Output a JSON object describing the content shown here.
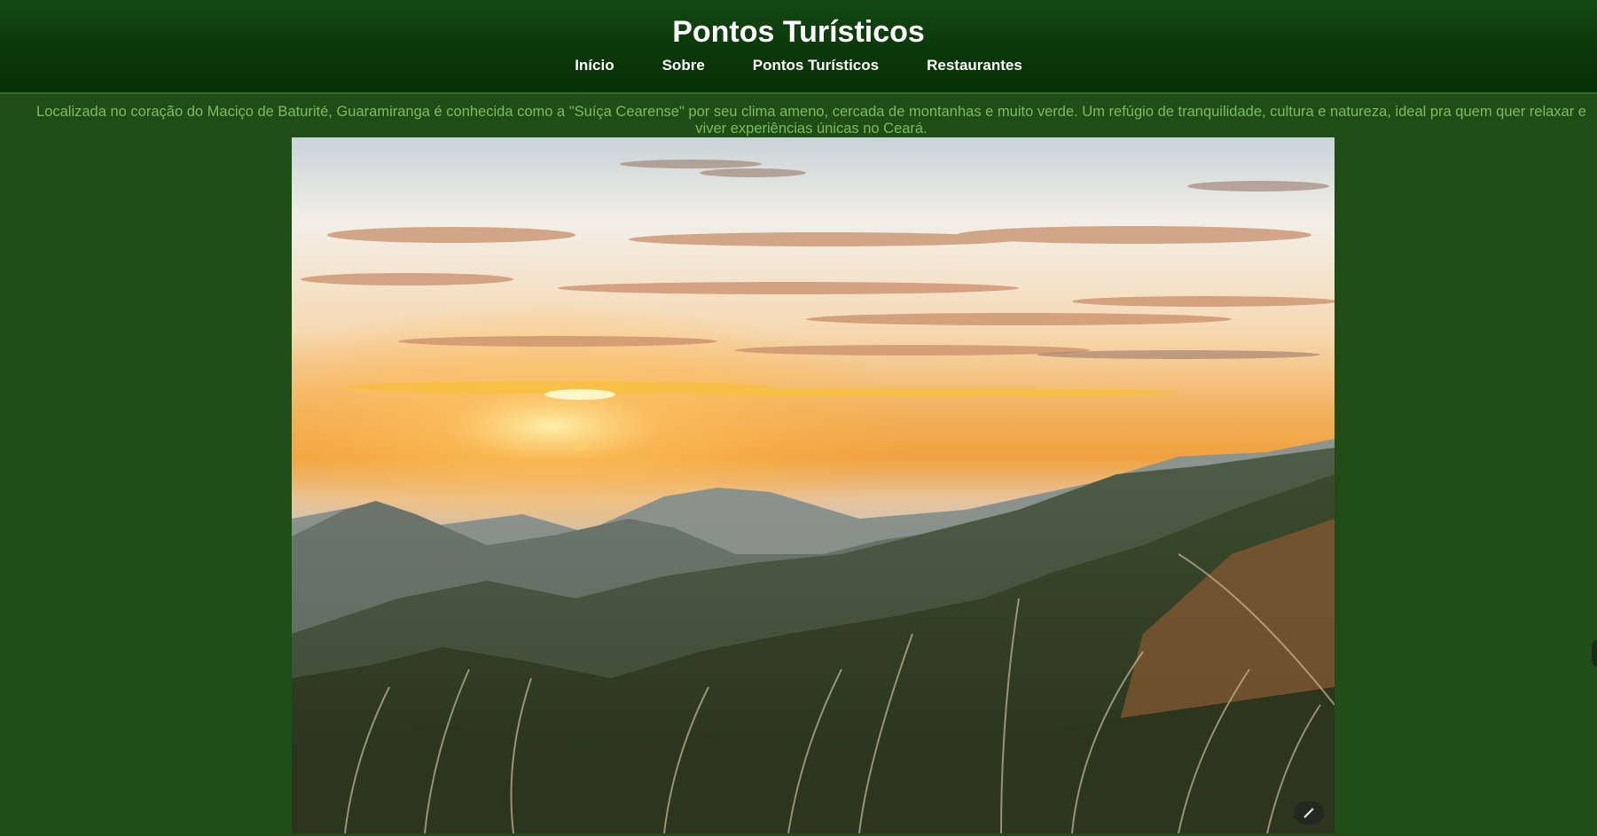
{
  "header": {
    "title": "Pontos Turísticos",
    "nav": [
      {
        "label": "Início"
      },
      {
        "label": "Sobre"
      },
      {
        "label": "Pontos Turísticos"
      },
      {
        "label": "Restaurantes"
      }
    ]
  },
  "main": {
    "intro": "Localizada no coração do Maciço de Baturité, Guaramiranga é conhecida como a \"Suíça Cearense\" por seu clima ameno, cercada de montanhas e muito verde. Um refúgio de tranquilidade, cultura e natureza, ideal pra quem quer relaxar e viver experiências únicas no Ceará.",
    "photo": {
      "subject": "sunset-over-mountains",
      "overlay_icon": "magic-wand-icon"
    }
  },
  "colors": {
    "page_background": "#1e4d16",
    "header_background": "#0c3a0c",
    "intro_text": "#7dbb62",
    "nav_text": "#ffffff"
  }
}
